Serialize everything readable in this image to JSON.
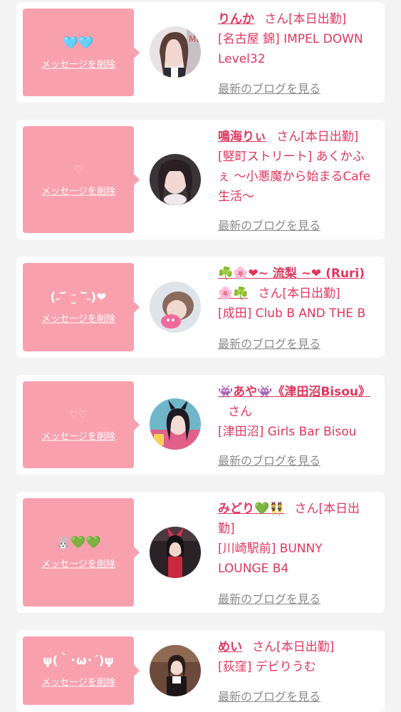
{
  "entries": [
    {
      "message": "🩵🩵",
      "delete_label": "メッセージを削除",
      "name": "りんか",
      "suffix": "さん",
      "status": "[本日出勤]",
      "shop": "[名古屋 錦] IMPEL DOWN Level32",
      "blog_label": "最新のブログを見る"
    },
    {
      "message": "♡",
      "delete_label": "メッセージを削除",
      "name": "鳴海りぃ",
      "suffix": "さん",
      "status": "[本日出勤]",
      "shop": "[竪町ストリート] あくかふぇ 〜小悪魔から始まるCafe生活〜",
      "blog_label": "最新のブログを見る"
    },
    {
      "message": "(˶‾᷄ ⁻̫ ‾᷅˵)❤",
      "delete_label": "メッセージを削除",
      "name": "☘️🌸❤~ 流梨 ~❤ (Ruri)🌸☘️",
      "suffix": "さん",
      "status": "[本日出勤]",
      "shop": "[成田] Club B AND THE B",
      "blog_label": "最新のブログを見る"
    },
    {
      "message": "♡♡",
      "delete_label": "メッセージを削除",
      "name": "👾あや👾《津田沼Bisou》",
      "suffix": "さん",
      "status": "",
      "shop": "[津田沼] Girls Bar Bisou",
      "blog_label": "最新のブログを見る"
    },
    {
      "message": "🐰💚💚",
      "delete_label": "メッセージを削除",
      "name": "みどり💚👯",
      "suffix": "さん",
      "status": "[本日出勤]",
      "shop": "[川崎駅前] BUNNY LOUNGE B4",
      "blog_label": "最新のブログを見る"
    },
    {
      "message": "ψ(｀･ω･´)ψ",
      "delete_label": "メッセージを削除",
      "name": "めい",
      "suffix": "さん",
      "status": "[本日出勤]",
      "shop": "[荻窪] デビりうむ",
      "blog_label": "最新のブログを見る"
    }
  ],
  "colors": {
    "page_background": "#f3f3f3",
    "card_background": "#ffffff",
    "bubble": "#f9a0ae",
    "accent": "#e3365d",
    "blog_link": "#8a8a8a"
  }
}
